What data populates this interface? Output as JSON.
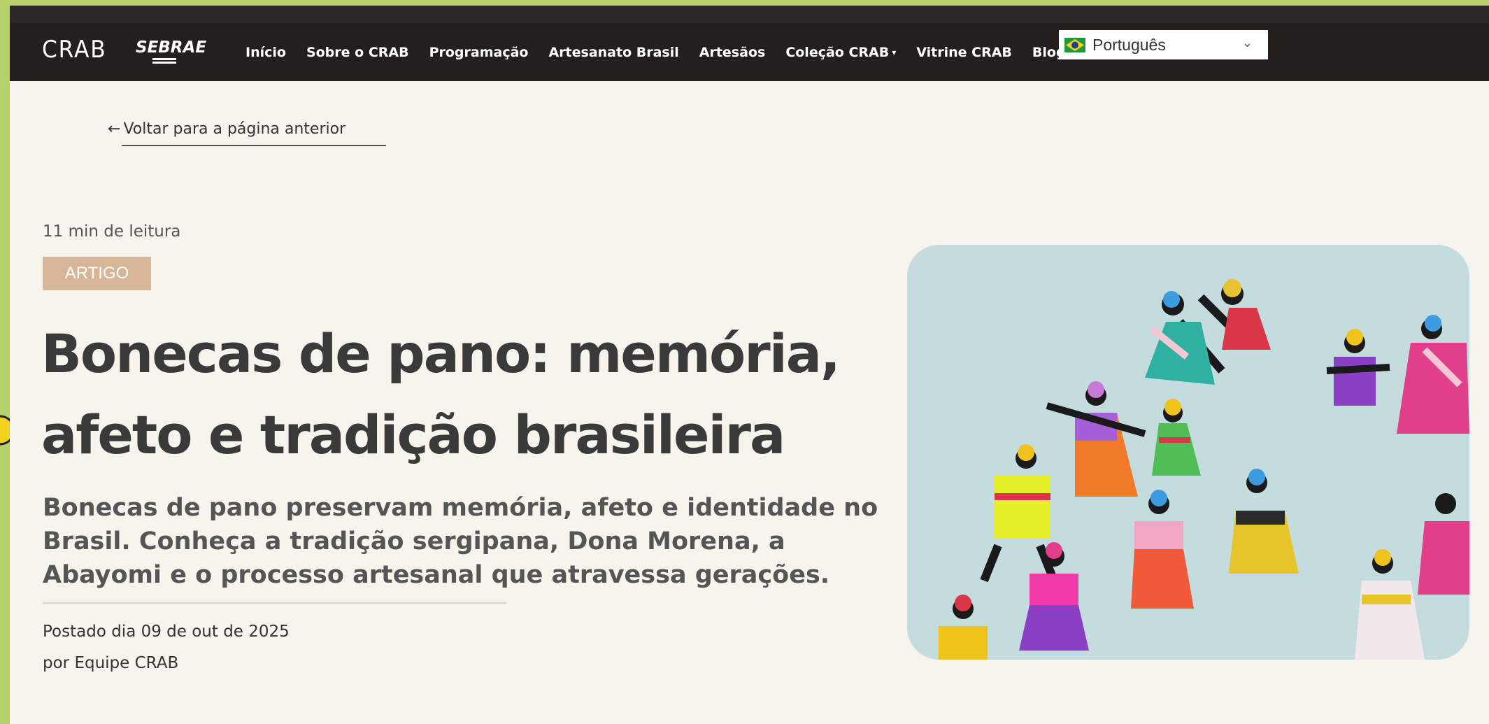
{
  "nav": {
    "logo_crab": "CRAB",
    "logo_sebrae": "SEBRAE",
    "items": [
      "Início",
      "Sobre o CRAB",
      "Programação",
      "Artesanato Brasil",
      "Artesãos",
      "Coleção CRAB",
      "Vitrine CRAB",
      "Blog"
    ],
    "language": "Português"
  },
  "article": {
    "back_link": "Voltar para a página anterior",
    "reading_time": "11 min de leitura",
    "badge": "ARTIGO",
    "title_line1": "Bonecas de pano: memória,",
    "title_line2": "afeto e tradição brasileira",
    "subtitle_line1": "Bonecas de pano preservam memória, afeto e identidade no",
    "subtitle_line2": "Brasil. Conheça a tradição sergipana, Dona Morena, a",
    "subtitle_line3": "Abayomi e o processo artesanal que atravessa gerações.",
    "posted": "Postado dia 09 de out de 2025",
    "author": "por Equipe CRAB"
  },
  "colors": {
    "outer_bg": "#b5cf6b",
    "page_bg": "#f7f4ee",
    "navbar_bg": "#231f1d",
    "badge_bg": "#d6b697",
    "title": "#3a3a3a"
  },
  "icons": {
    "back": "arrow-left-icon",
    "flag": "brazil-flag-icon",
    "dropdown": "chevron-down-icon"
  }
}
